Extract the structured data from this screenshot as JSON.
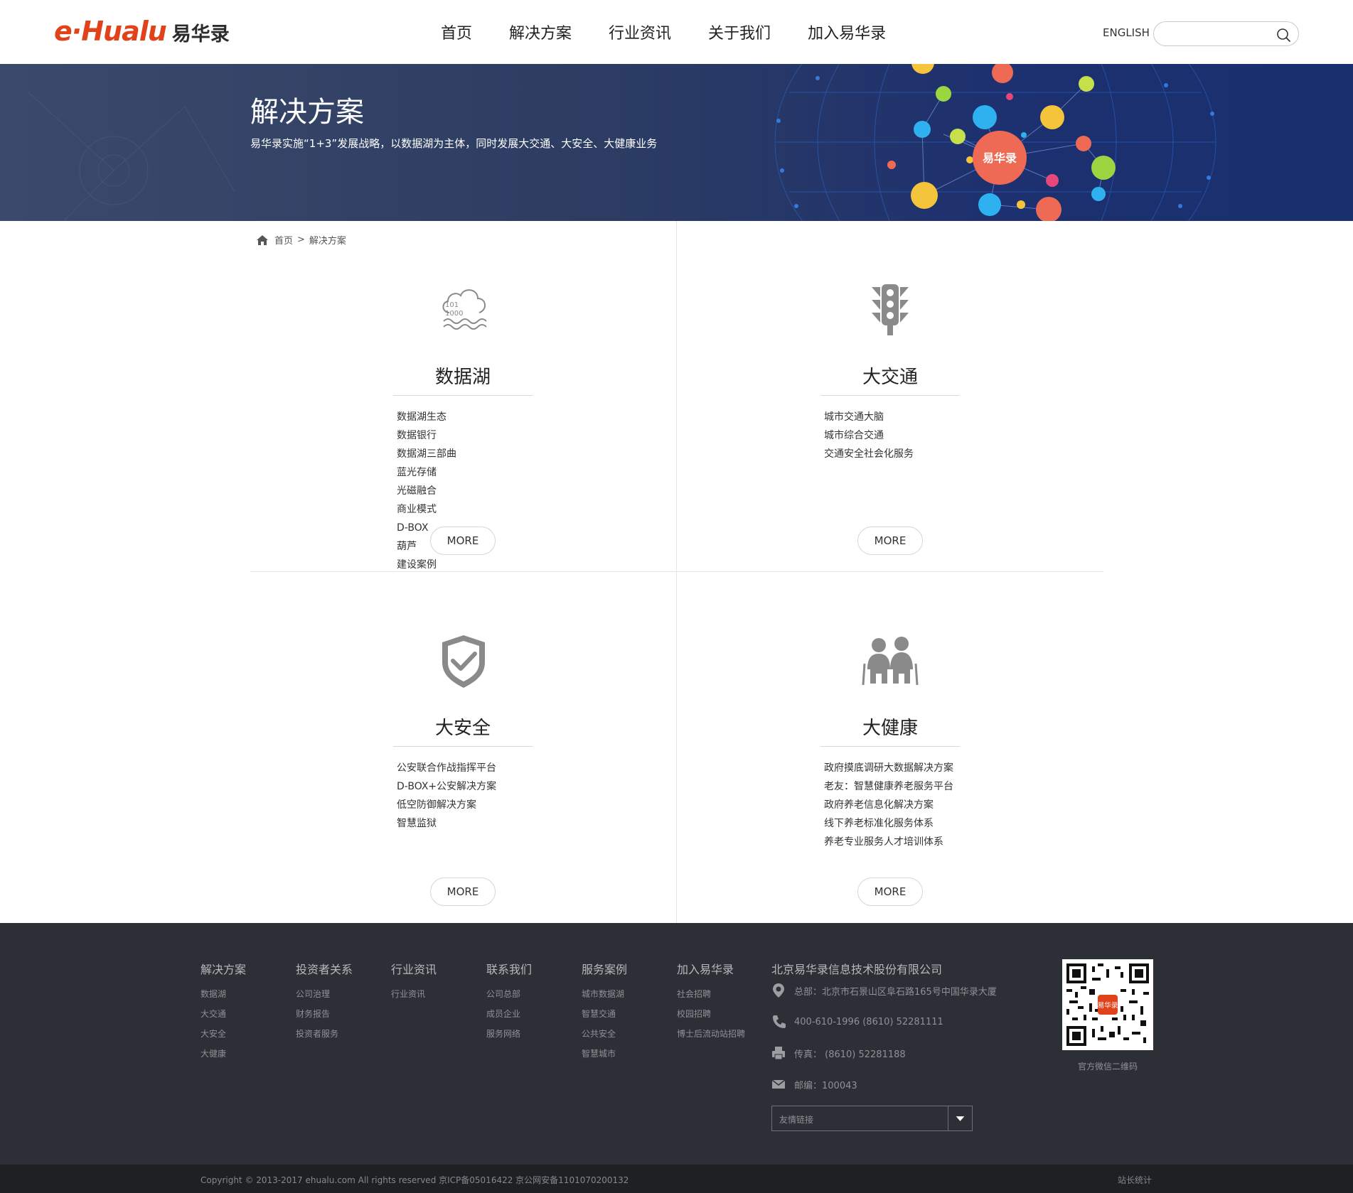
{
  "header": {
    "logo_en": "e·Hualu",
    "logo_cn": "易华录",
    "nav": [
      "首页",
      "解决方案",
      "行业资讯",
      "关于我们",
      "加入易华录"
    ],
    "lang": "ENGLISH",
    "search_placeholder": ""
  },
  "banner": {
    "title": "解决方案",
    "subtitle": "易华录实施“1+3”发展战略，以数据湖为主体，同时发展大交通、大安全、大健康业务",
    "center_badge": "易华录"
  },
  "breadcrumb": {
    "home": "首页",
    "sep": ">",
    "current": "解决方案"
  },
  "solutions": [
    {
      "title": "数据湖",
      "icon": "data-lake-cloud-icon",
      "icon_text_1": "101",
      "icon_text_2": "1000",
      "items": [
        "数据湖生态",
        "数据银行",
        "数据湖三部曲",
        "蓝光存储",
        "光磁融合",
        "商业模式",
        "D-BOX",
        "葫芦",
        "建设案例"
      ],
      "more": "MORE"
    },
    {
      "title": "大交通",
      "icon": "traffic-light-icon",
      "items": [
        "城市交通大脑",
        "城市综合交通",
        "交通安全社会化服务"
      ],
      "more": "MORE"
    },
    {
      "title": "大安全",
      "icon": "shield-check-icon",
      "items": [
        "公安联合作战指挥平台",
        "D-BOX+公安解决方案",
        "低空防御解决方案",
        "智慧监狱"
      ],
      "more": "MORE"
    },
    {
      "title": "大健康",
      "icon": "elderly-couple-icon",
      "items": [
        "政府摸底调研大数据解决方案",
        "老友：智慧健康养老服务平台",
        "政府养老信息化解决方案",
        "线下养老标准化服务体系",
        "养老专业服务人才培训体系"
      ],
      "more": "MORE"
    }
  ],
  "footer": {
    "columns": [
      {
        "head": "解决方案",
        "links": [
          "数据湖",
          "大交通",
          "大安全",
          "大健康"
        ]
      },
      {
        "head": "投资者关系",
        "links": [
          "公司治理",
          "财务报告",
          "投资者服务"
        ]
      },
      {
        "head": "行业资讯",
        "links": [
          "行业资讯"
        ]
      },
      {
        "head": "联系我们",
        "links": [
          "公司总部",
          "成员企业",
          "服务网络"
        ]
      },
      {
        "head": "服务案例",
        "links": [
          "城市数据湖",
          "智慧交通",
          "公共安全",
          "智慧城市"
        ]
      },
      {
        "head": "加入易华录",
        "links": [
          "社会招聘",
          "校园招聘",
          "博士后流动站招聘"
        ]
      }
    ],
    "company": "北京易华录信息技术股份有限公司",
    "address": "总部：北京市石景山区阜石路165号中国华录大厦",
    "phone": "400-610-1996   (8610)  52281111",
    "fax": "传真：  (8610)  52281188",
    "postcode": "邮编：100043",
    "friend_links": "友情链接",
    "qr_caption": "官方微信二维码",
    "qr_badge": "易华录",
    "copyright": "Copyright © 2013-2017 ehualu.com All rights reserved 京ICP备05016422    京公网安备1101070200132",
    "stats": "站长统计"
  },
  "colors": {
    "brand": "#e0431a",
    "banner_bg": "#2c3c62",
    "footer_bg": "#2c2f35",
    "copy_bg": "#1e2024",
    "icon_gray": "#8a8a8a"
  }
}
